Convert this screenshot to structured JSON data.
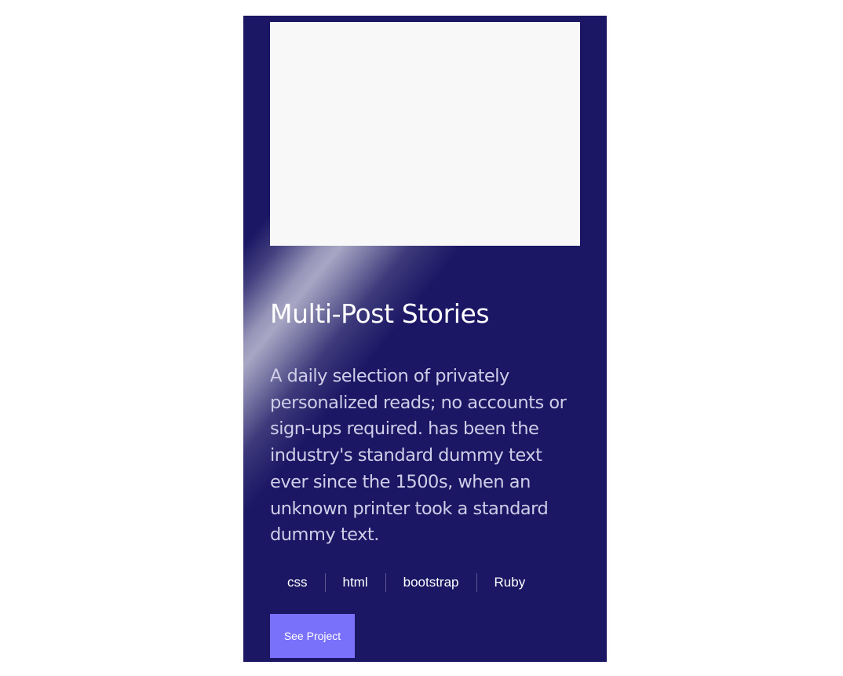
{
  "card": {
    "title": "Multi-Post Stories",
    "description": "A daily selection of privately personalized reads; no accounts or sign-ups required. has been the industry's standard dummy text ever since the 1500s, when an unknown printer took a standard dummy text.",
    "tags": [
      "css",
      "html",
      "bootstrap",
      "Ruby"
    ],
    "button_label": "See Project"
  },
  "colors": {
    "card_background": "#1b1764",
    "image_placeholder": "#f8f8f8",
    "button_background": "#7a71fb",
    "title_text": "#ffffff",
    "description_text": "#cfcde8"
  }
}
